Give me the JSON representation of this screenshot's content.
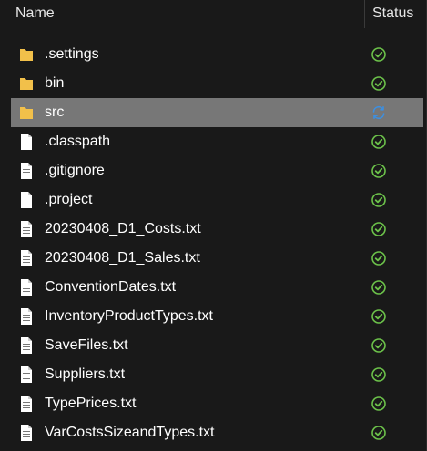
{
  "header": {
    "name_label": "Name",
    "status_label": "Status"
  },
  "colors": {
    "background": "#191919",
    "selected_row": "#777777",
    "folder": "#f2c04a",
    "status_ok": "#6cc24a",
    "status_sync": "#3d8fe0"
  },
  "files": [
    {
      "name": ".settings",
      "type": "folder",
      "status": "synced-check-icon",
      "selected": false
    },
    {
      "name": "bin",
      "type": "folder",
      "status": "synced-check-icon",
      "selected": false
    },
    {
      "name": "src",
      "type": "folder",
      "status": "sync-pending-icon",
      "selected": true
    },
    {
      "name": ".classpath",
      "type": "file-blank",
      "status": "synced-check-icon",
      "selected": false
    },
    {
      "name": ".gitignore",
      "type": "file-lines",
      "status": "synced-check-icon",
      "selected": false
    },
    {
      "name": ".project",
      "type": "file-blank",
      "status": "synced-check-icon",
      "selected": false
    },
    {
      "name": "20230408_D1_Costs.txt",
      "type": "file-lines",
      "status": "synced-check-icon",
      "selected": false
    },
    {
      "name": "20230408_D1_Sales.txt",
      "type": "file-lines",
      "status": "synced-check-icon",
      "selected": false
    },
    {
      "name": "ConventionDates.txt",
      "type": "file-lines",
      "status": "synced-check-icon",
      "selected": false
    },
    {
      "name": "InventoryProductTypes.txt",
      "type": "file-lines",
      "status": "synced-check-icon",
      "selected": false
    },
    {
      "name": "SaveFiles.txt",
      "type": "file-lines",
      "status": "synced-check-icon",
      "selected": false
    },
    {
      "name": "Suppliers.txt",
      "type": "file-lines",
      "status": "synced-check-icon",
      "selected": false
    },
    {
      "name": "TypePrices.txt",
      "type": "file-lines",
      "status": "synced-check-icon",
      "selected": false
    },
    {
      "name": "VarCostsSizeandTypes.txt",
      "type": "file-lines",
      "status": "synced-check-icon",
      "selected": false
    }
  ]
}
